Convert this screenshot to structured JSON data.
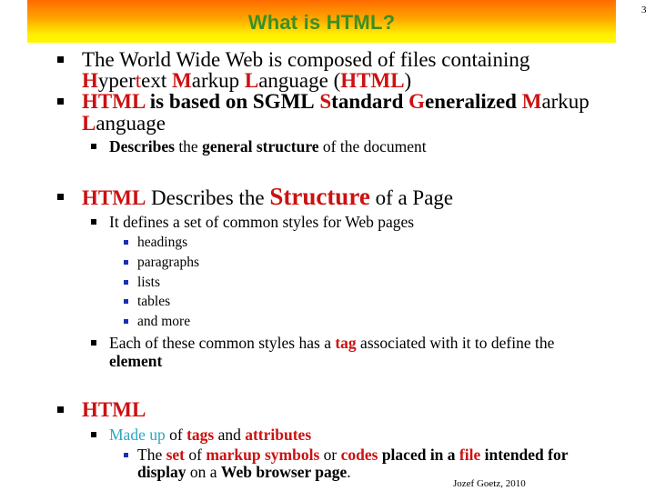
{
  "slide": {
    "title": "What is HTML?",
    "page_number": "3",
    "footer": "Jozef Goetz, 2010",
    "colors": {
      "title_text": "#3b8f23",
      "title_gradient_top": "#ff6a00",
      "title_gradient_bottom": "#fff700",
      "emphasis_red": "#cc1111",
      "emphasis_cyan": "#2aa6c4",
      "level3_bullet": "#1a2fb3"
    }
  },
  "b1": {
    "l1": "The World Wide Web is composed of files containing",
    "H": "H",
    "yper": "yper",
    "t": "t",
    "ext": "ext ",
    "M": "M",
    "arkup": "arkup ",
    "L": "L",
    "anguage": "anguage (",
    "HTML": "HTML",
    "close": ")"
  },
  "b2": {
    "HTML": "HTML",
    "is_based_on": " is based on ",
    "SGML": "SGML",
    "S": "S",
    "tandard": "tandard ",
    "G": "G",
    "eneralized": "eneralized ",
    "M": "M",
    "arkup": "arkup",
    "L": "L",
    "anguage": "anguage"
  },
  "b2_sub": {
    "describes": "Describes",
    "the": " the ",
    "general_structure": "general structure",
    "rest": " of the document"
  },
  "b3": {
    "HTML": "HTML",
    "describes_the": " Describes the ",
    "Structure": "Structure",
    "rest": " of a Page"
  },
  "b3_sub1": "It defines a set of common styles for Web pages",
  "b3_items": [
    "headings",
    "paragraphs",
    "lists",
    "tables",
    "and more"
  ],
  "b3_sub2": {
    "pre": "Each of these common styles has a ",
    "tag": "tag",
    "post": " associated with it to define the",
    "element": "element"
  },
  "b4": {
    "HTML": "HTML"
  },
  "b4_sub": {
    "made_up": "Made up",
    "of": " of ",
    "tags": "tags",
    "and": " and ",
    "attributes": "attributes"
  },
  "b4_sub_sub": {
    "the": "The ",
    "set": "set",
    "of": " of ",
    "markup_symbols": "markup symbols",
    "or": " or ",
    "codes": "codes",
    "placed_in_a": " placed in a ",
    "file": "file",
    "intended_for": " intended for",
    "display": "display",
    "on_a": " on a ",
    "web_browser_page": "Web browser page",
    "period": "."
  }
}
